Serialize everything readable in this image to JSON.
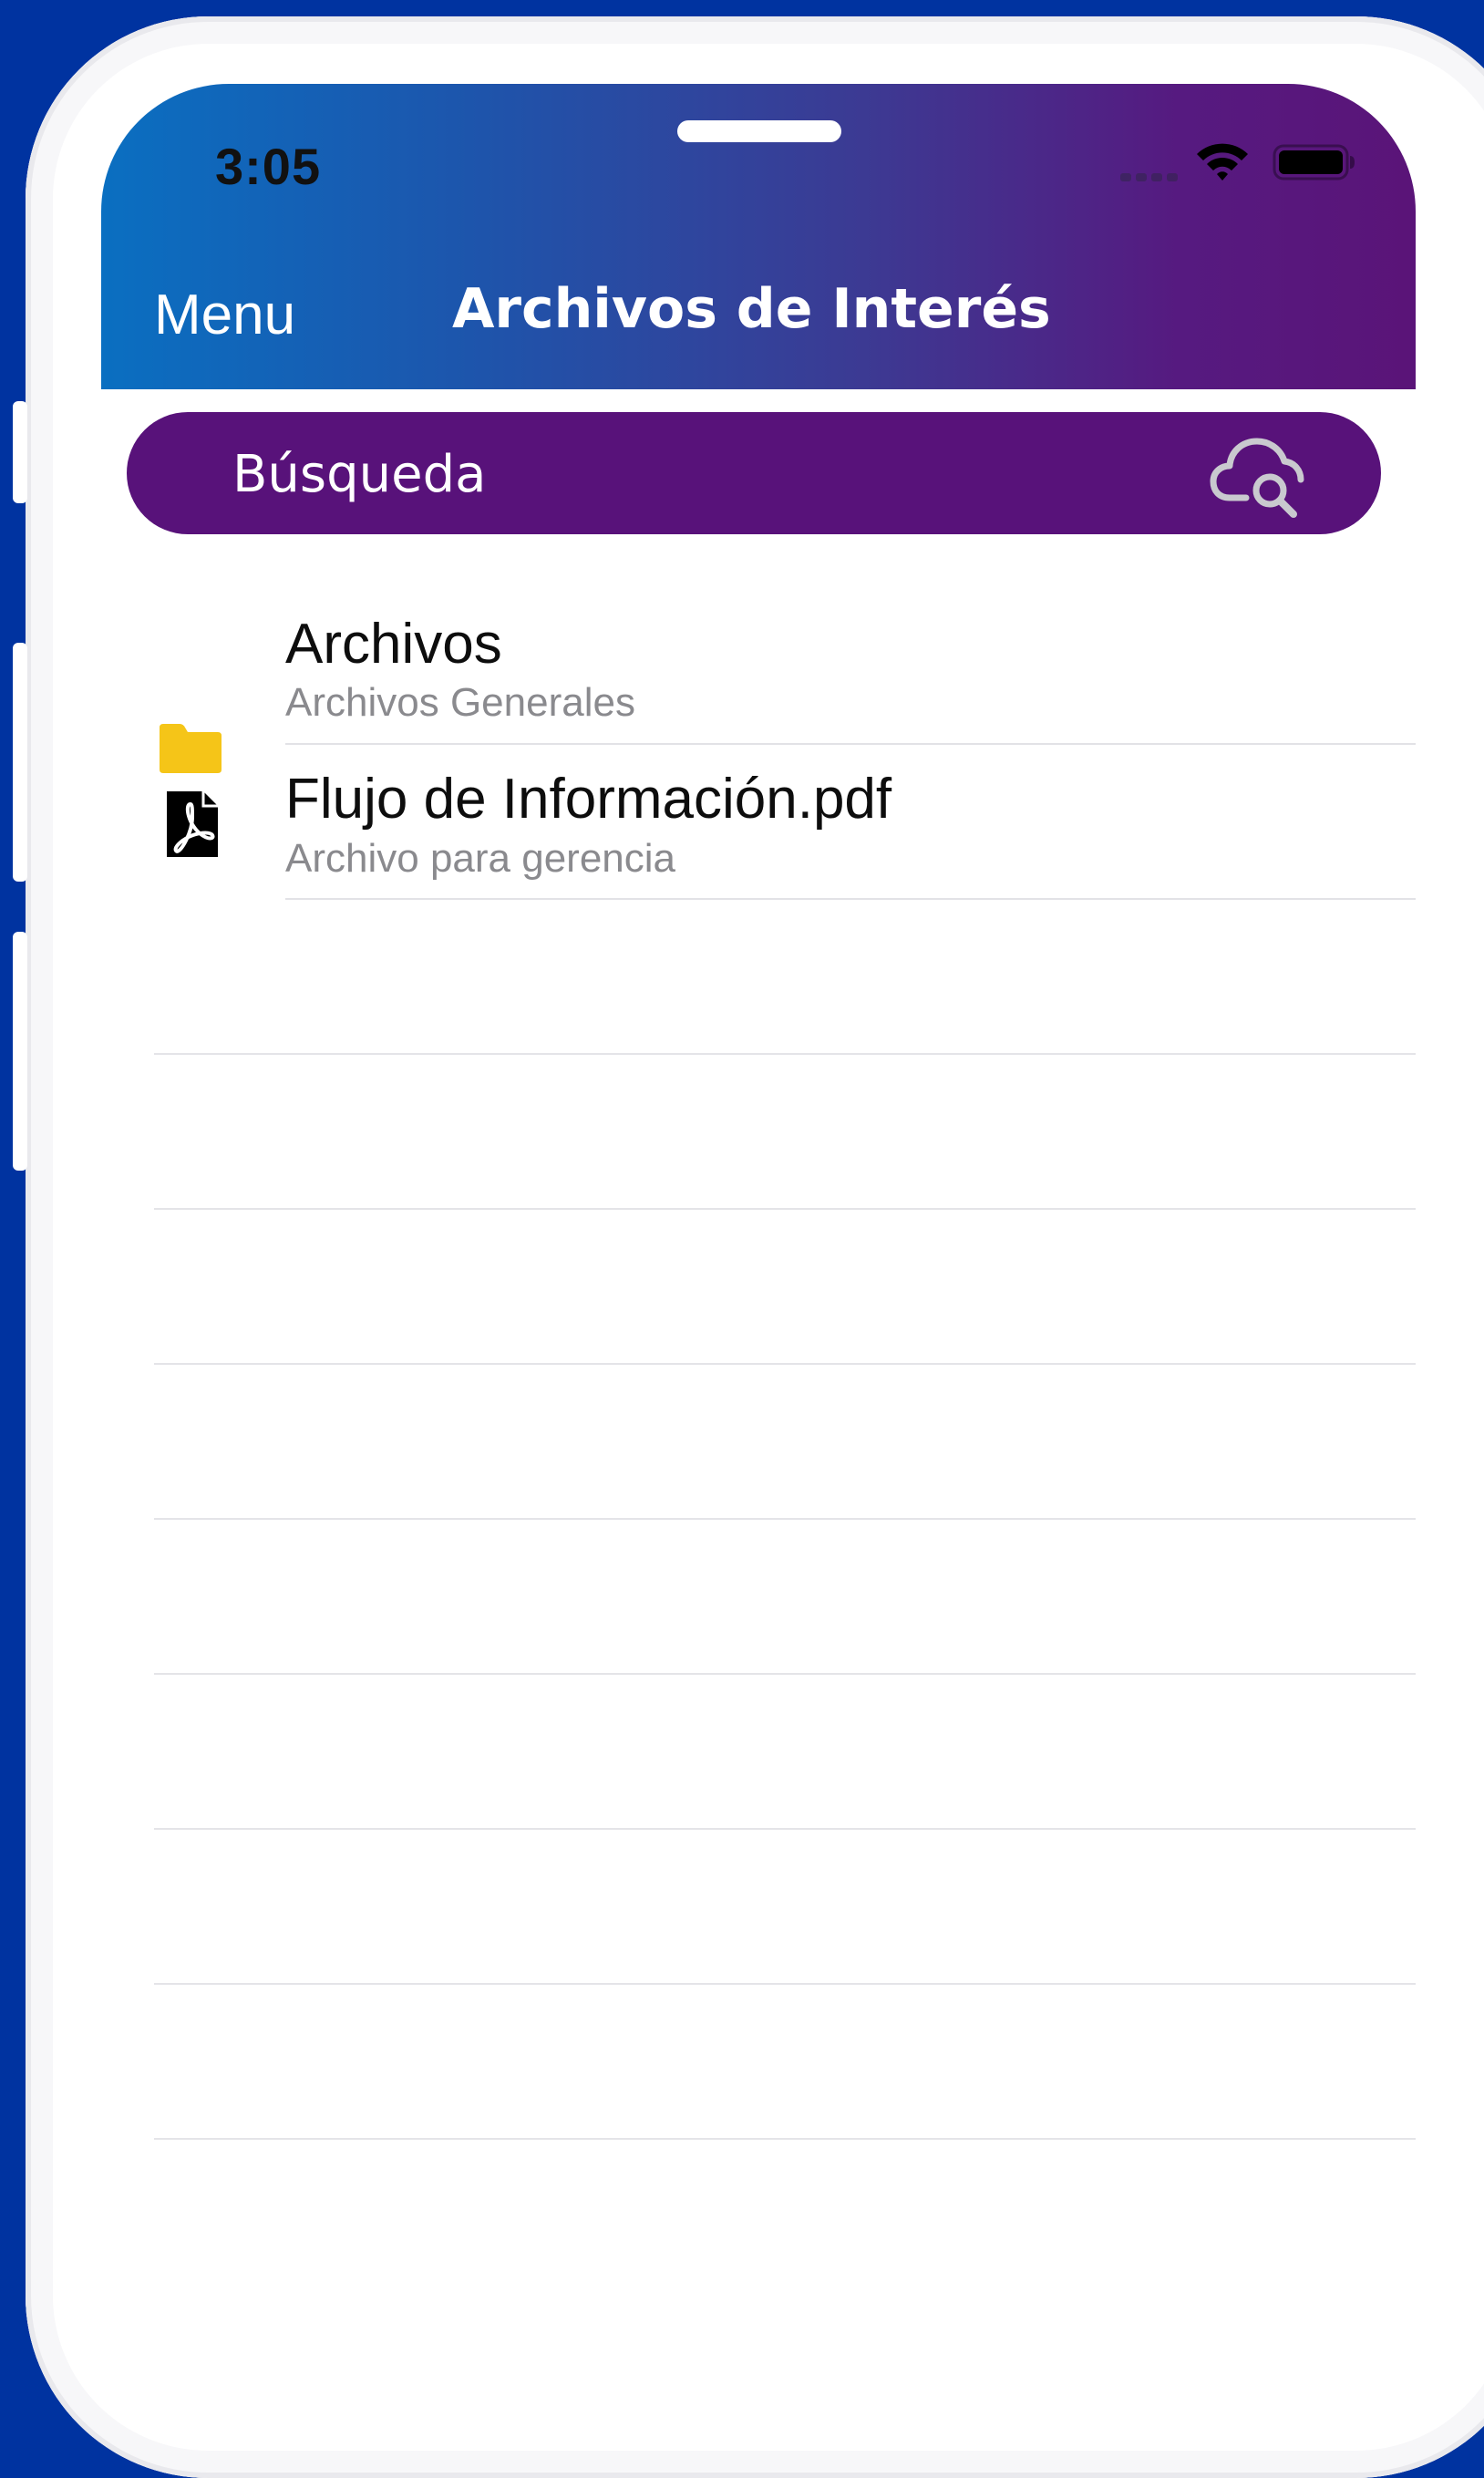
{
  "status_bar": {
    "time": "3:05"
  },
  "header": {
    "menu_label": "Menu",
    "title": "Archivos de Interés",
    "gradient_start": "#0a6fc1",
    "gradient_end": "#5a1478"
  },
  "search": {
    "placeholder": "Búsqueda",
    "icon": "cloud-search-icon",
    "background": "#58127a"
  },
  "files": [
    {
      "title": "Archivos",
      "subtitle": "Archivos Generales",
      "icon": "folder-icon",
      "icon_color": "#f5c518"
    },
    {
      "title": "Flujo de Información.pdf",
      "subtitle": "Archivo para gerencia",
      "icon": "pdf-file-icon",
      "icon_color": "#000000"
    }
  ],
  "colors": {
    "device_background": "#0033a0",
    "accent_purple": "#58127a"
  }
}
